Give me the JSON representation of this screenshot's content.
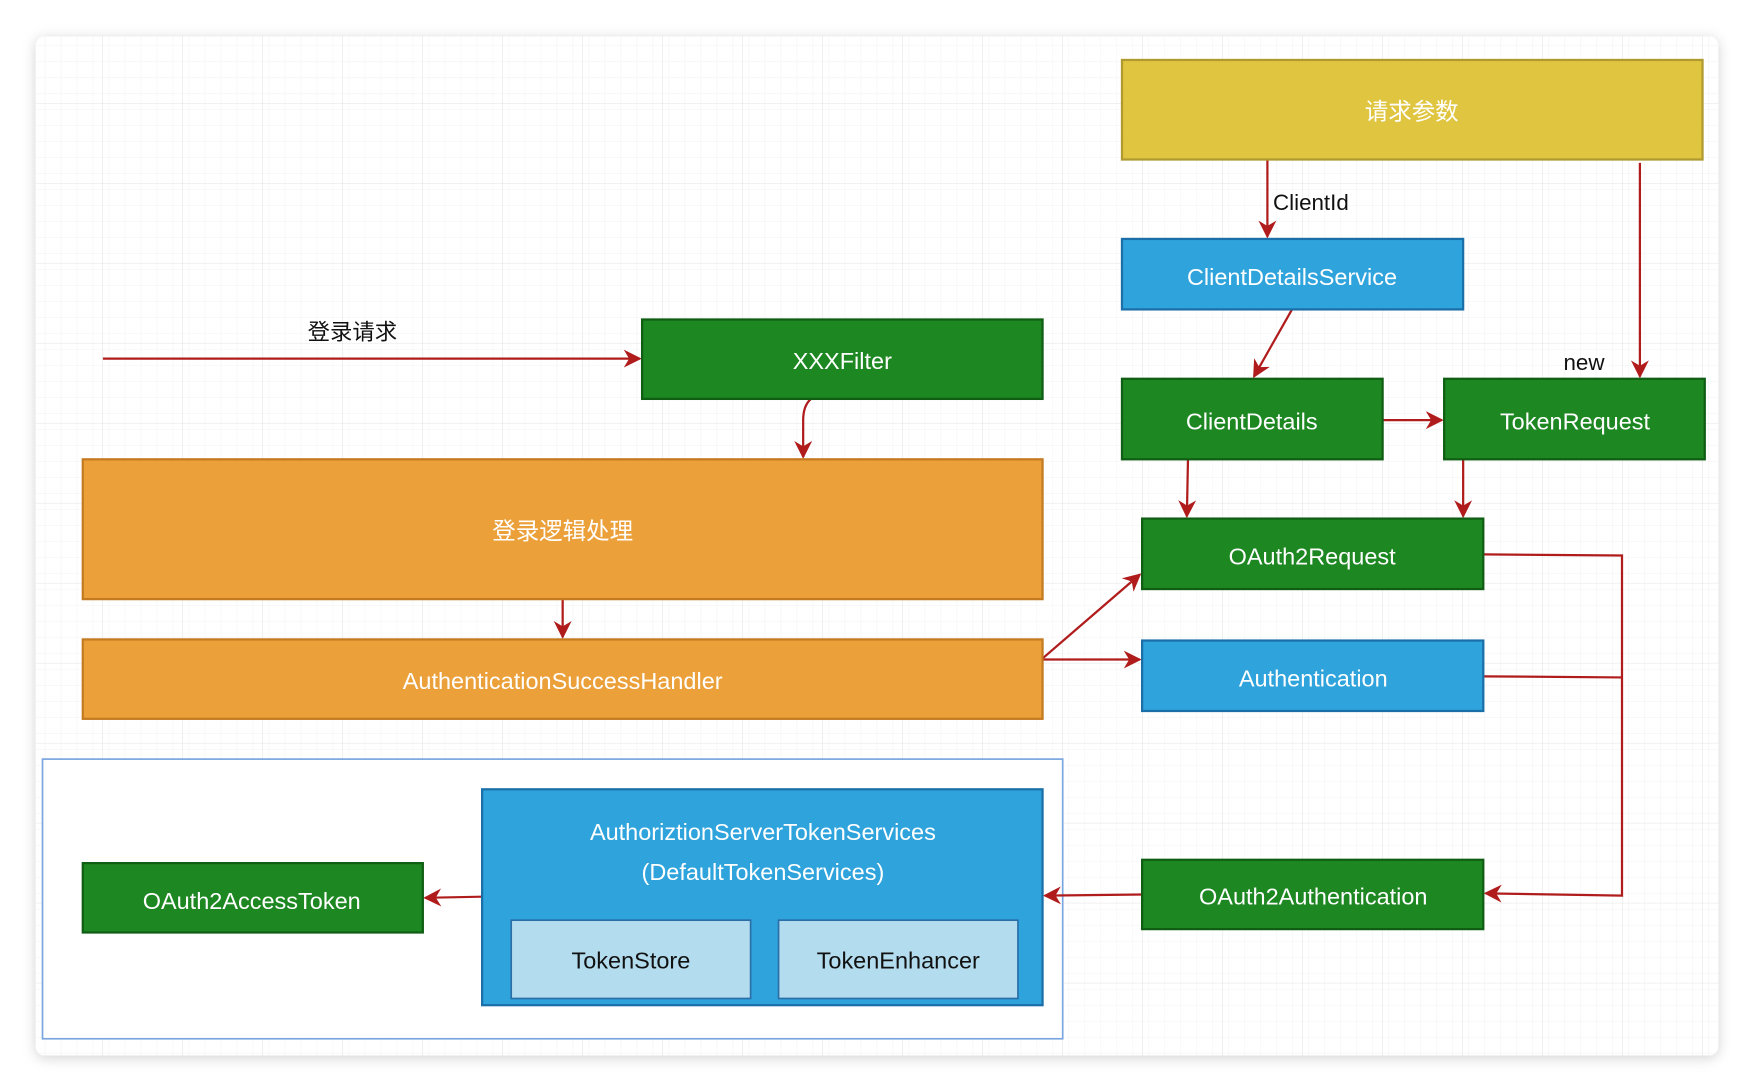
{
  "colors": {
    "yellow": "#e0c540",
    "blue": "#2fa3dc",
    "green": "#1d8722",
    "orange": "#eba03a",
    "light_blue": "#b3dcee",
    "edge": "#b01c1c",
    "frame": "#7aa5e0"
  },
  "nodes": {
    "request_params": "请求参数",
    "client_details_service": "ClientDetailsService",
    "xxx_filter": "XXXFilter",
    "client_details": "ClientDetails",
    "token_request": "TokenRequest",
    "oauth2_request": "OAuth2Request",
    "login_logic": "登录逻辑处理",
    "auth_success_handler": "AuthenticationSuccessHandler",
    "authentication": "Authentication",
    "token_services_line1": "AuthoriztionServerTokenServices",
    "token_services_line2": "(DefaultTokenServices)",
    "token_store": "TokenStore",
    "token_enhancer": "TokenEnhancer",
    "oauth2_access_token": "OAuth2AccessToken",
    "oauth2_authentication": "OAuth2Authentication"
  },
  "edge_labels": {
    "login_request": "登录请求",
    "client_id": "ClientId",
    "new": "new"
  }
}
